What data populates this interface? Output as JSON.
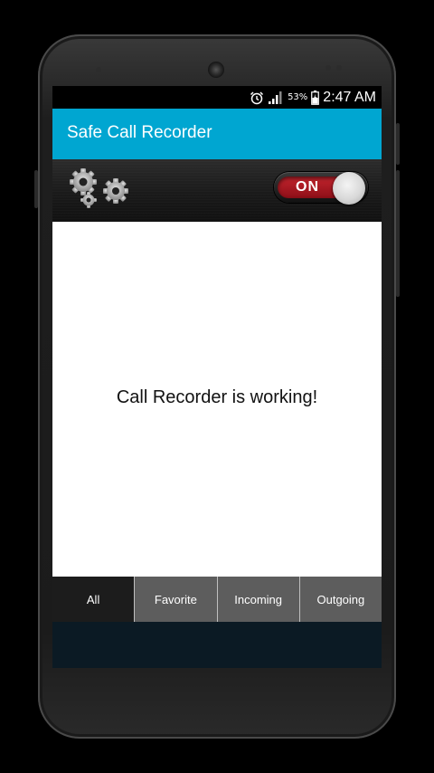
{
  "status": {
    "icons": [
      "alarm-icon",
      "signal-icon",
      "battery-icon"
    ],
    "battery_percent": "53%",
    "time": "2:47 AM"
  },
  "app": {
    "title": "Safe Call Recorder",
    "accent_color": "#00a6d1"
  },
  "toolbar": {
    "settings_icon": "gears-icon",
    "toggle_label": "ON",
    "toggle_color": "#c2242d"
  },
  "main": {
    "message": "Call Recorder is working!"
  },
  "tabs": [
    {
      "label": "All",
      "active": true
    },
    {
      "label": "Favorite",
      "active": false
    },
    {
      "label": "Incoming",
      "active": false
    },
    {
      "label": "Outgoing",
      "active": false
    }
  ]
}
